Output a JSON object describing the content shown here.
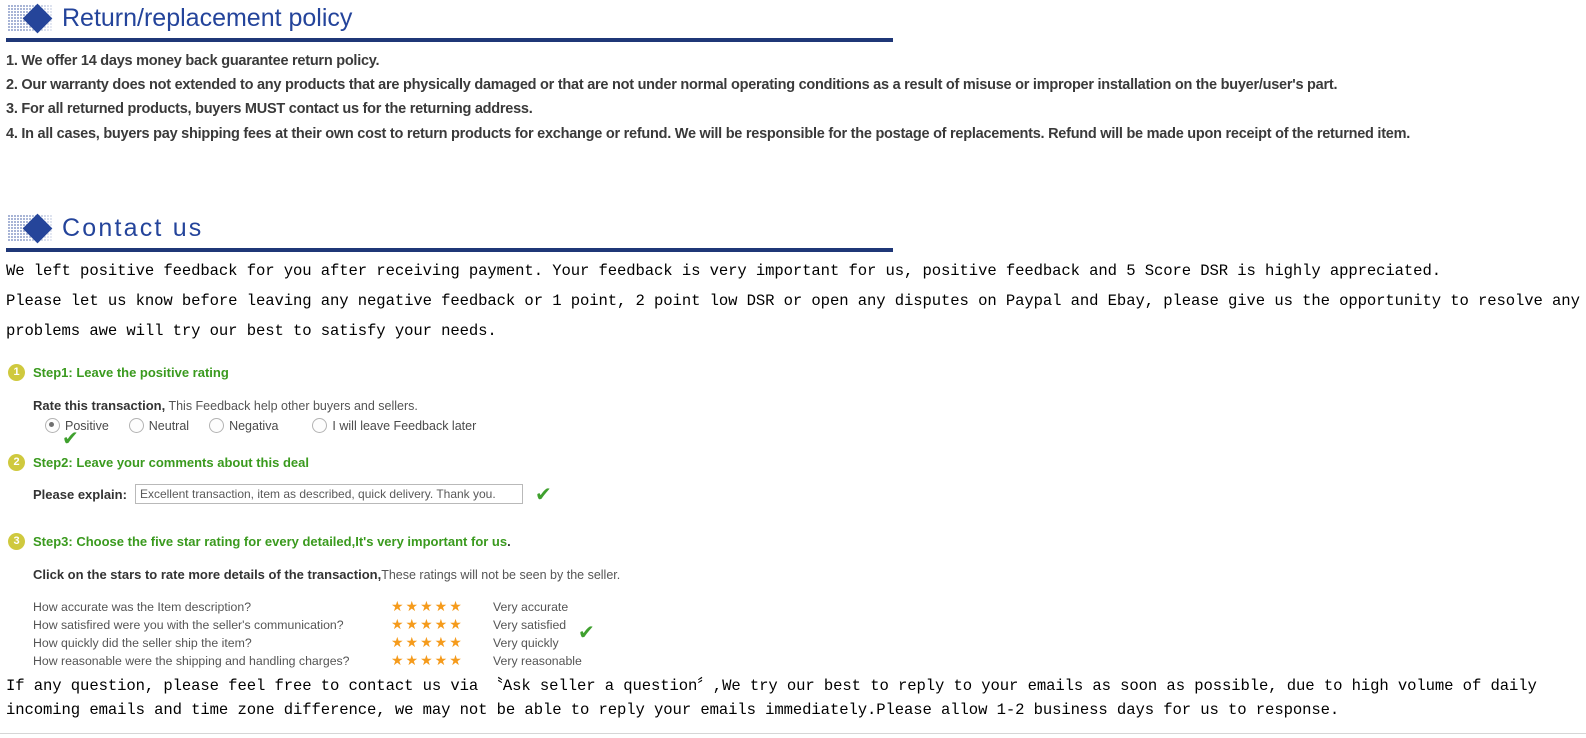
{
  "sections": {
    "return_policy": {
      "icon": "diamond-grid-icon",
      "title": "Return/replacement policy",
      "items": [
        "1. We offer 14 days money back guarantee return policy.",
        "2. Our warranty does not extended to any products that are physically damaged or that are not under normal operating conditions as a result of misuse or improper installation on the buyer/user's part.",
        "3. For all returned products, buyers MUST contact us for the returning address.",
        "4. In all cases, buyers pay shipping fees at their own cost to return products for exchange or refund. We will be responsible for the postage of replacements. Refund will be made upon receipt of the returned item."
      ]
    },
    "contact_us": {
      "icon": "diamond-grid-icon",
      "title": "Contact us",
      "paragraph1": "We left positive feedback for you after receiving payment. Your feedback is very important for us, positive feedback and 5 Score DSR is highly appreciated.",
      "paragraph2": "Please let us know before leaving any negative feedback or 1 point, 2 point low DSR or open any disputes on Paypal and Ebay, please give us the opportunity to resolve any problems awe will try our best to satisfy your needs.",
      "closing1": "If any question, please feel free to contact us via 〝Ask seller a question〞,We try our best to reply to your emails as soon as possible, due to high volume of daily",
      "closing2": "incoming emails and time zone difference, we may not be able to reply your emails immediately.Please allow 1-2 business days for us to response."
    }
  },
  "steps": [
    {
      "badge": "1",
      "label_green": "Step1: Leave the positive rating",
      "label_tail": ""
    },
    {
      "badge": "2",
      "label_green": "Step2: Leave your comments about this deal",
      "label_tail": ""
    },
    {
      "badge": "3",
      "label_green": "Step3: Choose the five star rating for every detailed,It's very important for us",
      "label_tail": "."
    }
  ],
  "step1": {
    "rate_label": "Rate this transaction,",
    "rate_hint": " This Feedback help other buyers and sellers.",
    "options": [
      {
        "label": "Positive",
        "checked": true
      },
      {
        "label": "Neutral",
        "checked": false
      },
      {
        "label": "Negativa",
        "checked": false
      },
      {
        "label": "I will leave Feedback later",
        "checked": false
      }
    ],
    "tick": "✔"
  },
  "step2": {
    "explain_label": "Please explain:",
    "explain_value": "Excellent transaction, item as described, quick delivery. Thank you.",
    "explain_placeholder": "Excellent transaction, item as described, quick delivery. Thank you.",
    "tick": "✔"
  },
  "step3": {
    "click_label": "Click on the stars to rate more details of the transaction,",
    "click_hint": "These ratings will not be seen by the seller.",
    "stars_glyph": "★★★★★",
    "tick": "✔",
    "rows": [
      {
        "question": "How accurate was the Item description?",
        "stars": 5,
        "word": "Very accurate"
      },
      {
        "question": "How satisfired were you with the seller's communication?",
        "stars": 5,
        "word": "Very satisfied"
      },
      {
        "question": "How quickly did the seller ship the item?",
        "stars": 5,
        "word": "Very quickly"
      },
      {
        "question": "How reasonable were the shipping and handling charges?",
        "stars": 5,
        "word": "Very reasonable"
      }
    ]
  },
  "colors": {
    "header_blue": "#24449b",
    "rule_navy": "#1f3777",
    "step_green": "#3a9a1e",
    "badge_yellow": "#cfc93e",
    "star_orange": "#f59b1c",
    "tick_green": "#3fa02e"
  }
}
